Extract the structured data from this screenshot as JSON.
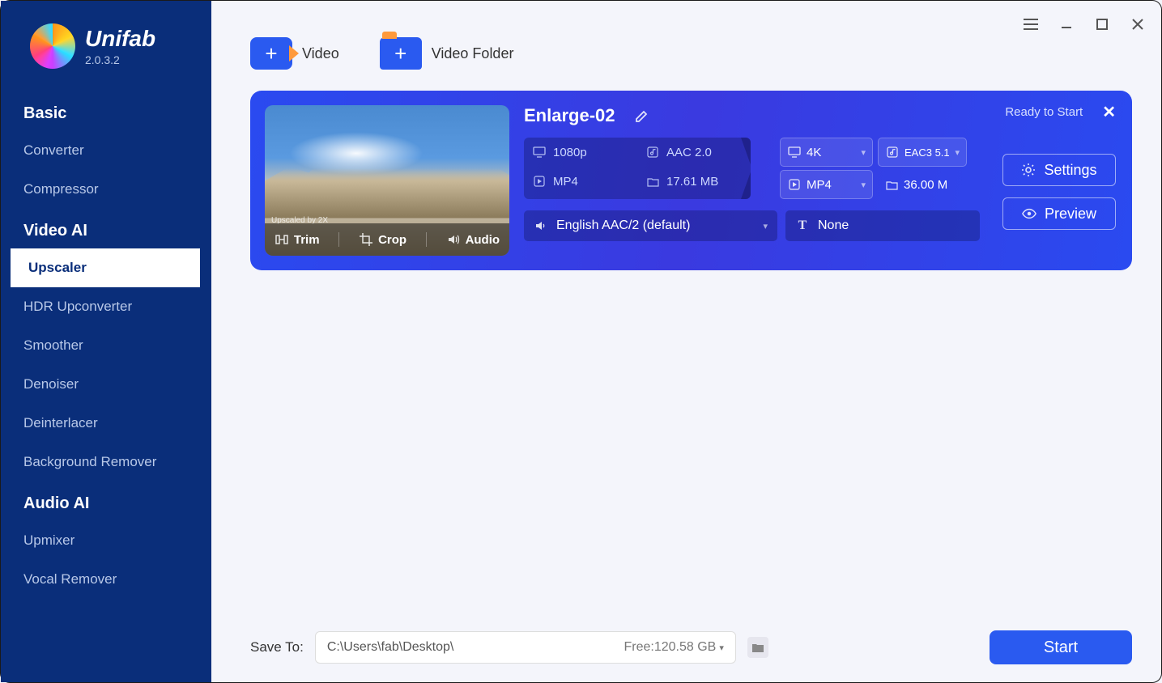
{
  "app": {
    "name": "Unifab",
    "version": "2.0.3.2"
  },
  "sidebar": {
    "groups": [
      {
        "title": "Basic",
        "items": [
          "Converter",
          "Compressor"
        ]
      },
      {
        "title": "Video AI",
        "items": [
          "Upscaler",
          "HDR Upconverter",
          "Smoother",
          "Denoiser",
          "Deinterlacer",
          "Background Remover"
        ],
        "active": "Upscaler"
      },
      {
        "title": "Audio AI",
        "items": [
          "Upmixer",
          "Vocal Remover"
        ]
      }
    ]
  },
  "add": {
    "video": "Video",
    "folder": "Video Folder"
  },
  "task": {
    "status": "Ready to Start",
    "title": "Enlarge-02",
    "thumb_caption": "Upscaled by 2X",
    "tools": {
      "trim": "Trim",
      "crop": "Crop",
      "audio": "Audio"
    },
    "source": {
      "res": "1080p",
      "audio": "AAC 2.0",
      "container": "MP4",
      "size": "17.61 MB"
    },
    "target": {
      "res": "4K",
      "audio": "EAC3 5.1",
      "container": "MP4",
      "size": "36.00 M"
    },
    "audio_track": "English AAC/2 (default)",
    "subtitle": "None",
    "actions": {
      "settings": "Settings",
      "preview": "Preview"
    }
  },
  "footer": {
    "label": "Save To:",
    "path": "C:\\Users\\fab\\Desktop\\",
    "free": "Free:120.58 GB",
    "start": "Start"
  }
}
